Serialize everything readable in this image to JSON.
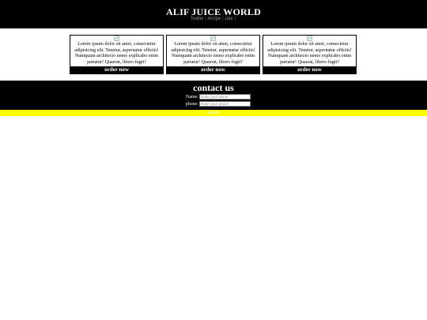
{
  "header": {
    "title": "ALIF JUICE WORLD",
    "nav": [
      {
        "label": "home"
      },
      {
        "label": "recipe"
      },
      {
        "label": "rate"
      }
    ],
    "separator": "|"
  },
  "cards": [
    {
      "image_icon": "broken-image-icon",
      "text": "Lorem ipsum dolor sit amet, consectetur adipisicing elit. Tenetur, aspernatur officiis! Numquam architecto nemo explicabo enim pariatur! Quaerat, libero fugit?",
      "button_label": "order now"
    },
    {
      "image_icon": "broken-image-icon",
      "text": "Lorem ipsum dolor sit amet, consectetur adipisicing elit. Tenetur, aspernatur officiis! Numquam architecto nemo explicabo enim pariatur! Quaerat, libero fugit?",
      "button_label": "order now"
    },
    {
      "image_icon": "broken-image-icon",
      "text": "Lorem ipsum dolor sit amet, consectetur adipisicing elit. Tenetur, aspernatur officiis! Numquam architecto nemo explicabo enim pariatur! Quaerat, libero fugit?",
      "button_label": "order now"
    }
  ],
  "contact": {
    "title": "contact us",
    "name_label": "Name:",
    "name_placeholder": "Enter your Name",
    "phone_label": "phone:",
    "phone_placeholder": "Enter your phone",
    "submit_label": "Submit"
  },
  "colors": {
    "header_bg": "#000000",
    "contact_bg": "#000000",
    "submit_bar": "#ffff00",
    "text_light": "#ffffff"
  }
}
